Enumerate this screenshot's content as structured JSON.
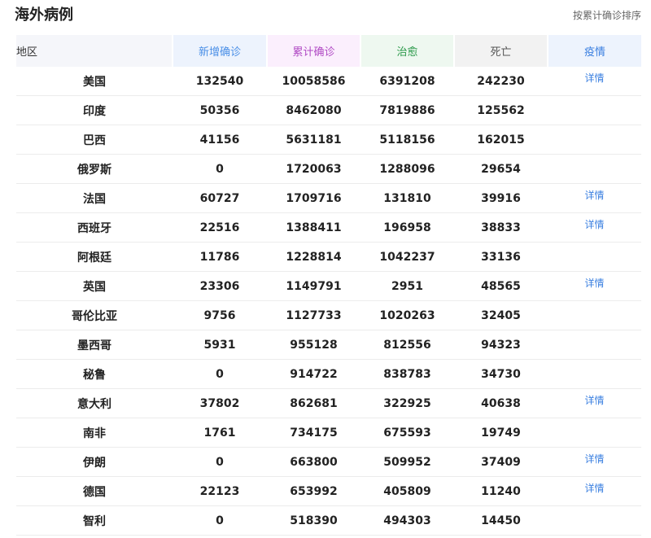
{
  "header": {
    "title": "海外病例",
    "sort_label": "按累计确诊排序"
  },
  "columns": {
    "region": "地区",
    "new_confirmed": "新增确诊",
    "total_confirmed": "累计确诊",
    "cured": "治愈",
    "deaths": "死亡",
    "epidemic": "疫情"
  },
  "rows": [
    {
      "region": "美国",
      "new": "132540",
      "total": "10058586",
      "cured": "6391208",
      "dead": "242230",
      "detail": "详情"
    },
    {
      "region": "印度",
      "new": "50356",
      "total": "8462080",
      "cured": "7819886",
      "dead": "125562",
      "detail": ""
    },
    {
      "region": "巴西",
      "new": "41156",
      "total": "5631181",
      "cured": "5118156",
      "dead": "162015",
      "detail": ""
    },
    {
      "region": "俄罗斯",
      "new": "0",
      "total": "1720063",
      "cured": "1288096",
      "dead": "29654",
      "detail": ""
    },
    {
      "region": "法国",
      "new": "60727",
      "total": "1709716",
      "cured": "131810",
      "dead": "39916",
      "detail": "详情"
    },
    {
      "region": "西班牙",
      "new": "22516",
      "total": "1388411",
      "cured": "196958",
      "dead": "38833",
      "detail": "详情"
    },
    {
      "region": "阿根廷",
      "new": "11786",
      "total": "1228814",
      "cured": "1042237",
      "dead": "33136",
      "detail": ""
    },
    {
      "region": "英国",
      "new": "23306",
      "total": "1149791",
      "cured": "2951",
      "dead": "48565",
      "detail": "详情"
    },
    {
      "region": "哥伦比亚",
      "new": "9756",
      "total": "1127733",
      "cured": "1020263",
      "dead": "32405",
      "detail": ""
    },
    {
      "region": "墨西哥",
      "new": "5931",
      "total": "955128",
      "cured": "812556",
      "dead": "94323",
      "detail": ""
    },
    {
      "region": "秘鲁",
      "new": "0",
      "total": "914722",
      "cured": "838783",
      "dead": "34730",
      "detail": ""
    },
    {
      "region": "意大利",
      "new": "37802",
      "total": "862681",
      "cured": "322925",
      "dead": "40638",
      "detail": "详情"
    },
    {
      "region": "南非",
      "new": "1761",
      "total": "734175",
      "cured": "675593",
      "dead": "19749",
      "detail": ""
    },
    {
      "region": "伊朗",
      "new": "0",
      "total": "663800",
      "cured": "509952",
      "dead": "37409",
      "detail": "详情"
    },
    {
      "region": "德国",
      "new": "22123",
      "total": "653992",
      "cured": "405809",
      "dead": "11240",
      "detail": "详情"
    },
    {
      "region": "智利",
      "new": "0",
      "total": "518390",
      "cured": "494303",
      "dead": "14450",
      "detail": ""
    }
  ],
  "colors": {
    "new_confirmed": "#3a7fe0",
    "total_header": "#b04ac4",
    "cured_header": "#2c9a4b",
    "link": "#3a7fe0"
  }
}
